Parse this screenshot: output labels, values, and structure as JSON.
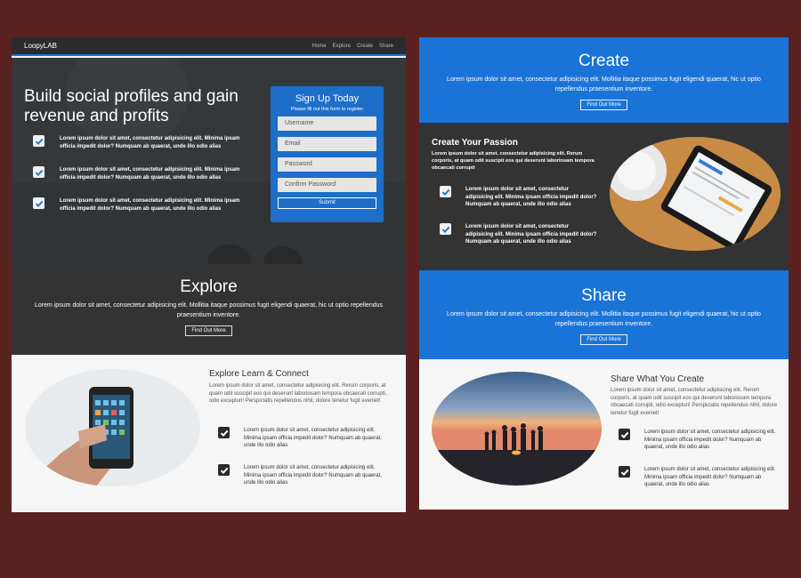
{
  "left": {
    "nav": {
      "brand": "LoopyLAB",
      "links": [
        "Home",
        "Explore",
        "Create",
        "Share"
      ]
    },
    "hero": {
      "title": "Build social profiles and gain revenue and profits",
      "checks": [
        "Lorem ipsum dolor sit amet, consectetur adipisicing elit. Minima ipsam officia impedit dolor? Numquam ab quaerat, unde illo odio alias",
        "Lorem ipsum dolor sit amet, consectetur adipisicing elit. Minima ipsam officia impedit dolor? Numquam ab quaerat, unde illo odio alias",
        "Lorem ipsum dolor sit amet, consectetur adipisicing elit. Minima ipsam officia impedit dolor? Numquam ab quaerat, unde illo odio alias"
      ]
    },
    "signup": {
      "title": "Sign Up Today",
      "subtitle": "Please fill out this form to register",
      "fields": [
        "Username",
        "Email",
        "Password",
        "Confirm Password"
      ],
      "submit": "Submit"
    },
    "explore": {
      "title": "Explore",
      "desc": "Lorem ipsum dolor sit amet, consectetur adipisicing elit. Mollitia itaque possimus fugit eligendi quaerat, hic ut optio repellendus praesentium inventore.",
      "button": "Find Out More"
    },
    "learn": {
      "title": "Explore Learn & Connect",
      "desc": "Lorem ipsum dolor sit amet, consectetur adipisicing elit. Rerum corporis, at quam odit suscipit eos qui deserunt laboriosam tempora obcaecati corrupti, odio excepturi! Perspiciatis repellendus nihil, dolore tenetur fugit eveniet!",
      "checks": [
        "Lorem ipsum dolor sit amet, consectetur adipisicing elit. Minima ipsam officia impedit dolor? Numquam ab quaerat, unde illo odio alias",
        "Lorem ipsum dolor sit amet, consectetur adipisicing elit. Minima ipsam officia impedit dolor? Numquam ab quaerat, unde illo odio alias"
      ]
    }
  },
  "right": {
    "create": {
      "title": "Create",
      "desc": "Lorem ipsum dolor sit amet, consectetur adipisicing elit. Mollitia itaque possimus fugit eligendi quaerat, hic ut optio repellendus praesentium inventore.",
      "button": "Find Out More"
    },
    "passion": {
      "title": "Create Your Passion",
      "desc": "Lorem ipsum dolor sit amet, consectetur adipisicing elit. Rerum corporis, at quam odit suscipit eos qui deserunt laboriosam tempora obcaecati corrupti",
      "checks": [
        "Lorem ipsum dolor sit amet, consectetur adipisicing elit. Minima ipsam officia impedit dolor? Numquam ab quaerat, unde illo odio alias",
        "Lorem ipsum dolor sit amet, consectetur adipisicing elit. Minima ipsam officia impedit dolor? Numquam ab quaerat, unde illo odio alias"
      ]
    },
    "share": {
      "title": "Share",
      "desc": "Lorem ipsum dolor sit amet, consectetur adipisicing elit. Mollitia itaque possimus fugit eligendi quaerat, hic ut optio repellendus praesentium inventore.",
      "button": "Find Out More"
    },
    "shareWhat": {
      "title": "Share What You Create",
      "desc": "Lorem ipsum dolor sit amet, consectetur adipisicing elit. Rerum corporis, at quam odit suscipit eos qui deserunt laboriosam tempora obcaecati corrupti, odio excepturi! Perspiciatis repellendus nihil, dolore tenetur fugit eveniet!",
      "checks": [
        "Lorem ipsum dolor sit amet, consectetur adipisicing elit. Minima ipsam officia impedit dolor? Numquam ab quaerat, unde illo odio alias",
        "Lorem ipsum dolor sit amet, consectetur adipisicing elit. Minima ipsam officia impedit dolor? Numquam ab quaerat, unde illo odio alias"
      ]
    }
  },
  "colors": {
    "background": "#5a2121",
    "accent": "#1a74d8",
    "dark": "#333333",
    "light": "#f4f4f4"
  }
}
